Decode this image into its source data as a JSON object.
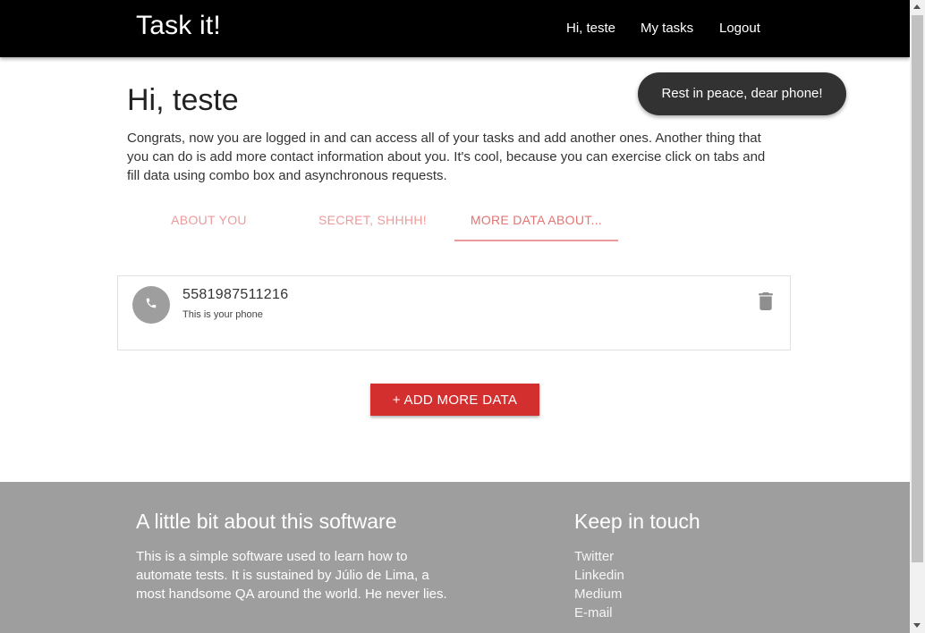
{
  "header": {
    "brand": "Task it!",
    "nav": {
      "greeting": "Hi, teste",
      "my_tasks": "My tasks",
      "logout": "Logout"
    }
  },
  "main": {
    "title": "Hi, teste",
    "intro": "Congrats, now you are logged in and can access all of your tasks and add another ones. Another thing that you can do is add more contact information about you. It's cool, because you can exercise click on tabs and fill data using combo box and asynchronous requests.",
    "tabs": [
      "About you",
      "Secret, shhhh!",
      "More data about..."
    ],
    "active_tab": 2
  },
  "contacts": [
    {
      "value": "5581987511216",
      "description": "This is your phone",
      "icon": "phone-icon"
    }
  ],
  "add_button": "+ Add more data",
  "toast": "Rest in peace, dear phone!",
  "footer": {
    "about_title": "A little bit about this software",
    "about_text": "This is a simple software used to learn how to automate tests. It is sustained by Júlio de Lima, a most handsome QA around the world. He never lies.",
    "contact_title": "Keep in touch",
    "links": [
      "Twitter",
      "Linkedin",
      "Medium",
      "E-mail"
    ]
  },
  "colors": {
    "navbar": "#000000",
    "accent": "#d32f2f",
    "tab_text": "#ef9a9a",
    "footer": "#9e9e9e",
    "toast": "#323232"
  }
}
